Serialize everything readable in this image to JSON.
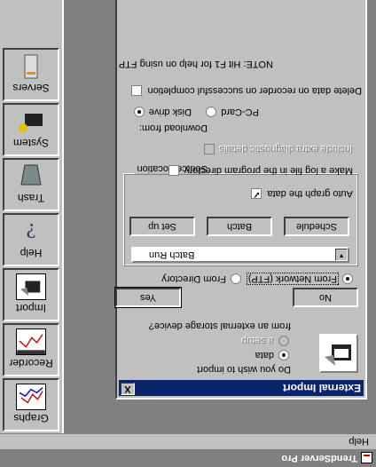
{
  "app": {
    "title": "TrendServer Pro"
  },
  "menu": {
    "items": [
      "Help"
    ]
  },
  "toolbar": {
    "buttons": [
      {
        "label": "Graphs",
        "icon": "graphs-icon"
      },
      {
        "label": "Recorder",
        "icon": "recorder-icon"
      },
      {
        "label": "Import",
        "icon": "import-icon"
      },
      {
        "label": "Help",
        "icon": "help-icon"
      },
      {
        "label": "Trash",
        "icon": "trash-icon"
      },
      {
        "label": "System",
        "icon": "system-icon"
      },
      {
        "label": "Servers",
        "icon": "servers-icon"
      }
    ]
  },
  "dialog": {
    "title": "External Import",
    "close_label": "X",
    "question": "Do you wish to import",
    "radio_data": "data",
    "radio_setup": "a setup",
    "question_suffix": "from an external storage device?",
    "yes_label": "Yes",
    "no_label": "No",
    "source_group_label": "Source Location",
    "from_directory": "From Directory",
    "from_network": "From Network (FTP)",
    "batch_select_value": "Batch Run",
    "setup_button": "Set up",
    "batch_button": "Batch",
    "schedule_button": "Schedule",
    "auto_graph": "Auto graph the data",
    "make_log": "Make a log file in the program directory",
    "include_diag": "Include extra diagnostic details",
    "download_from": "Download from:",
    "disk_drive": "Disk drive",
    "pc_card": "PC-Card",
    "delete_data": "Delete data on recorder on successful completion",
    "note": "NOTE: Hit F1 for help on using FTP"
  }
}
